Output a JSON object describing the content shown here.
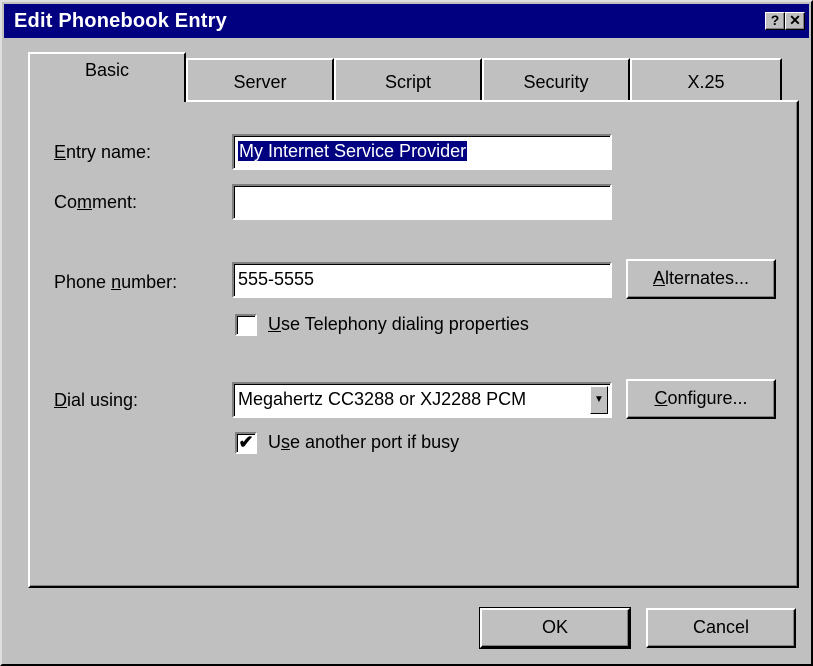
{
  "window": {
    "title": "Edit Phonebook Entry",
    "help_glyph": "?",
    "close_glyph": "✕"
  },
  "tabs": [
    {
      "label": "Basic",
      "active": true
    },
    {
      "label": "Server",
      "active": false
    },
    {
      "label": "Script",
      "active": false
    },
    {
      "label": "Security",
      "active": false
    },
    {
      "label": "X.25",
      "active": false
    }
  ],
  "form": {
    "entry_name": {
      "label_pre": "",
      "label_key": "E",
      "label_post": "ntry name:",
      "value": "My Internet Service Provider"
    },
    "comment": {
      "label_pre": "Co",
      "label_key": "m",
      "label_post": "ment:",
      "value": ""
    },
    "phone": {
      "label_pre": "Phone ",
      "label_key": "n",
      "label_post": "umber:",
      "value": "555-5555"
    },
    "alternates_button": {
      "label_key": "A",
      "label_post": "lternates..."
    },
    "telephony_checkbox": {
      "label_key": "U",
      "label_post": "se Telephony dialing properties",
      "checked": false
    },
    "dial_using": {
      "label_key": "D",
      "label_post": "ial using:",
      "value": "Megahertz CC3288 or XJ2288 PCM"
    },
    "configure_button": {
      "label_key": "C",
      "label_post": "onfigure..."
    },
    "another_port_checkbox": {
      "label_pre": "U",
      "label_key": "s",
      "label_post": "e another port if busy",
      "checked": true,
      "check_glyph": "✔"
    }
  },
  "footer": {
    "ok_label": "OK",
    "cancel_label": "Cancel"
  },
  "icons": {
    "dropdown_arrow": "▼"
  }
}
